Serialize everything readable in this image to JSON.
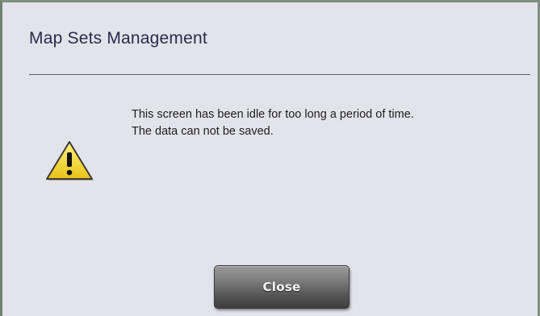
{
  "dialog": {
    "title": "Map Sets Management",
    "message_lines": [
      "This screen has been idle for too long a period of time.",
      "The data can not be saved."
    ],
    "icon": "warning-icon",
    "close_label": "Close"
  },
  "colors": {
    "background": "#e3e3ec",
    "border": "#7f8f80",
    "title": "#2b2b4a",
    "divider": "#5c5c6e",
    "warning_fill": "#f5dc2c",
    "button_dark": "#3e3e3e"
  }
}
